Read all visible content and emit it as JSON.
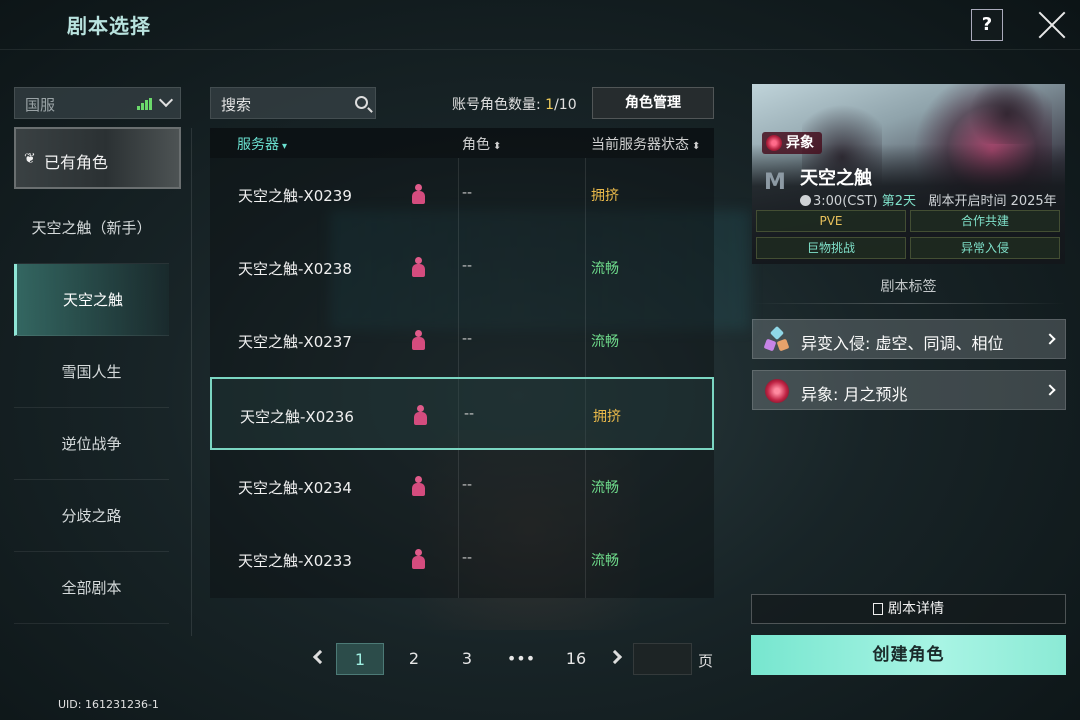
{
  "header": {
    "title": "剧本选择",
    "help_label": "?"
  },
  "sidebar": {
    "region": "国服",
    "have_role_label": "已有角色",
    "items": [
      {
        "label": "天空之触（新手）",
        "active": false
      },
      {
        "label": "天空之触",
        "active": true
      },
      {
        "label": "雪国人生",
        "active": false
      },
      {
        "label": "逆位战争",
        "active": false
      },
      {
        "label": "分歧之路",
        "active": false
      },
      {
        "label": "全部剧本",
        "active": false
      }
    ],
    "uid": "UID: 161231236-1"
  },
  "toolbar": {
    "search_placeholder": "搜索",
    "account_count_label": "账号角色数量: ",
    "account_count_value": "1",
    "account_count_total": "/10",
    "role_mgmt_label": "角色管理"
  },
  "table": {
    "headers": {
      "server": "服务器",
      "role": "角色",
      "status": "当前服务器状态"
    },
    "rows": [
      {
        "name": "天空之触-X0239",
        "role": "--",
        "status": "拥挤",
        "status_color": "#e8b84a",
        "selected": false
      },
      {
        "name": "天空之触-X0238",
        "role": "--",
        "status": "流畅",
        "status_color": "#6fdc8c",
        "selected": false
      },
      {
        "name": "天空之触-X0237",
        "role": "--",
        "status": "流畅",
        "status_color": "#6fdc8c",
        "selected": false
      },
      {
        "name": "天空之触-X0236",
        "role": "--",
        "status": "拥挤",
        "status_color": "#e8b84a",
        "selected": true
      },
      {
        "name": "天空之触-X0234",
        "role": "--",
        "status": "流畅",
        "status_color": "#6fdc8c",
        "selected": false
      },
      {
        "name": "天空之触-X0233",
        "role": "--",
        "status": "流畅",
        "status_color": "#6fdc8c",
        "selected": false
      }
    ]
  },
  "pagination": {
    "pages": [
      "1",
      "2",
      "3",
      "•••",
      "16"
    ],
    "current": "1",
    "suffix": "页"
  },
  "script_info": {
    "badge": "异象",
    "name": "天空之触",
    "time_text": "3:00(CST)",
    "day_text": "第2天",
    "open_time_text": "剧本开启时间 2025年",
    "tags": [
      "PVE",
      "合作共建",
      "巨物挑战",
      "异常入侵"
    ],
    "tags_label": "剧本标签",
    "tag_rows": [
      {
        "label": "异变入侵: 虚空、同调、相位",
        "icon": "anomaly-shapes-icon"
      },
      {
        "label": "异象: 月之预兆",
        "icon": "red-orb-icon"
      }
    ],
    "detail_label": "剧本详情",
    "create_label": "创建角色"
  },
  "colors": {
    "accent": "#7bd6c2",
    "crowded": "#e8b84a",
    "smooth": "#6fdc8c",
    "create_btn": "#8bead5"
  }
}
